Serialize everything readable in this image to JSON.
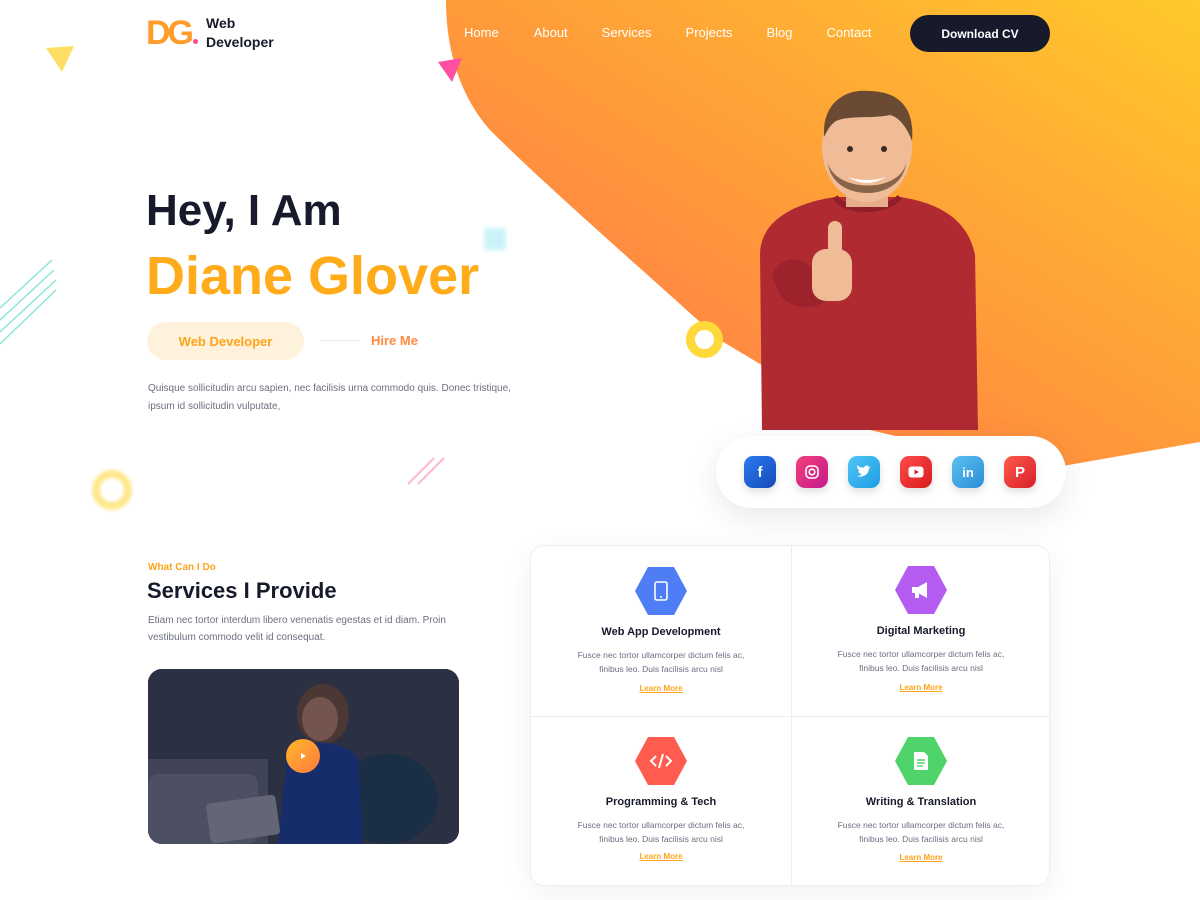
{
  "brand": {
    "mark": "DG",
    "line1": "Web",
    "line2": "Developer"
  },
  "nav": {
    "items": [
      "Home",
      "About",
      "Services",
      "Projects",
      "Blog",
      "Contact"
    ],
    "cta": "Download CV"
  },
  "hero": {
    "greeting": "Hey, I Am",
    "name": "Diane Glover",
    "role": "Web Developer",
    "hire": "Hire Me",
    "description": "Quisque sollicitudin arcu sapien, nec facilisis urna commodo quis. Donec tristique, ipsum id sollicitudin vulputate,"
  },
  "social": [
    "facebook",
    "instagram",
    "twitter",
    "youtube",
    "linkedin",
    "pinterest"
  ],
  "services": {
    "kicker": "What Can I Do",
    "title": "Services I Provide",
    "description": "Etiam nec tortor interdum libero venenatis egestas et id diam. Proin vestibulum commodo velit id consequat.",
    "cards": [
      {
        "title": "Web App Development",
        "desc": "Fusce nec tortor ullamcorper  dictum felis ac, finibus leo. Duis facilisis arcu nisl",
        "link": "Learn More",
        "icon": "mobile-icon",
        "color": "#4f7df5"
      },
      {
        "title": "Digital Marketing",
        "desc": "Fusce nec tortor ullamcorper  dictum felis ac, finibus leo. Duis facilisis arcu nisl",
        "link": "Learn More",
        "icon": "megaphone-icon",
        "color": "#b45cf2"
      },
      {
        "title": "Programming & Tech",
        "desc": "Fusce nec tortor ullamcorper  dictum felis ac, finibus leo. Duis facilisis arcu nisl",
        "link": "Learn More",
        "icon": "code-icon",
        "color": "#ff5b4f"
      },
      {
        "title": "Writing & Translation",
        "desc": "Fusce nec tortor ullamcorper  dictum felis ac, finibus leo. Duis facilisis arcu nisl",
        "link": "Learn More",
        "icon": "document-icon",
        "color": "#4fd36b"
      }
    ]
  },
  "colors": {
    "accent": "#ffab1a",
    "dark": "#161a2b",
    "gradient_start": "#ff7e48",
    "gradient_end": "#ffc52e"
  }
}
